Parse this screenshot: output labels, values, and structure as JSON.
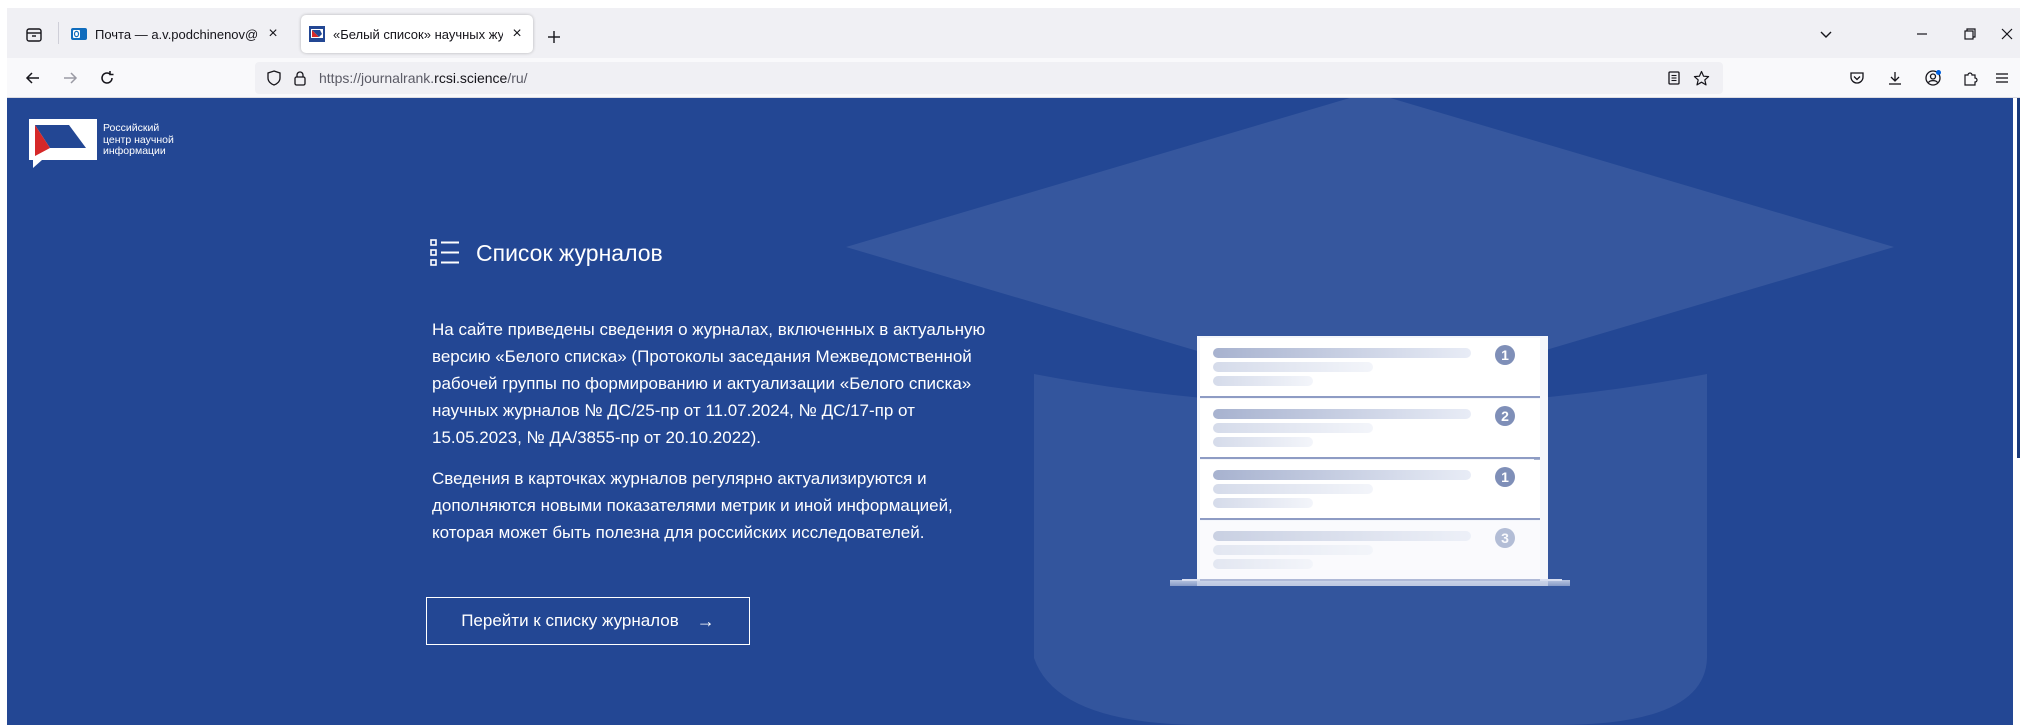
{
  "browser": {
    "tabs": [
      {
        "title": "Почта — a.v.podchinenov@urf",
        "active": false
      },
      {
        "title": "«Белый список» научных журн",
        "active": true
      }
    ],
    "url_prefix": "https://journalrank.",
    "url_domain": "rcsi.science",
    "url_suffix": "/ru/"
  },
  "logo": {
    "line1": "Российский",
    "line2": "центр научной",
    "line3": "информации"
  },
  "hero": {
    "heading": "Список журналов",
    "para1": "На сайте приведены сведения о журналах, включенных в актуальную версию «Белого списка» (Протоколы заседания Межведомственной рабочей группы по формированию и актуализации «Белого списка» научных журналов № ДС/25-пр от 11.07.2024, № ДС/17-пр от 15.05.2023, № ДА/3855-пр от 20.10.2022).",
    "para2": "Сведения в карточках журналов регулярно актуализируются и дополняются новыми показателями метрик и иной информацией, которая может быть полезна для российских исследователей.",
    "cta_label": "Перейти к списку журналов",
    "cta_arrow": "→"
  },
  "illustration": {
    "badges": [
      "1",
      "2",
      "1",
      "3"
    ]
  },
  "colors": {
    "hero_bg": "#234794",
    "cap": "#3a5aa0",
    "accent": "#7f8fb8"
  }
}
